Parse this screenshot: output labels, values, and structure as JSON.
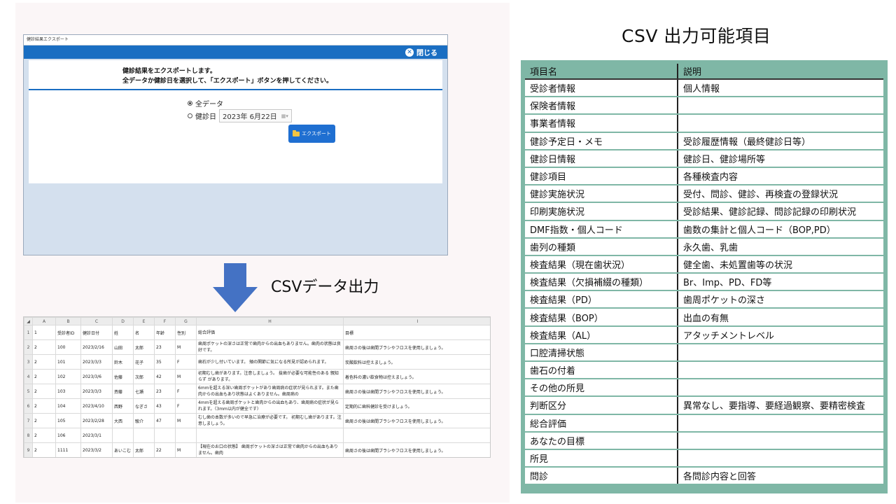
{
  "dialog": {
    "window_title": "健診結果エクスポート",
    "close_label": "閉じる",
    "message_line1": "健診結果をエクスポートします。",
    "message_line2": "全データか健診日を選択して、「エクスポート」ボタンを押してください。",
    "option_all": "全データ",
    "option_date": "健診日",
    "date_value": "2023年  6月22日",
    "export_button": "エクスポート"
  },
  "arrow_caption": "CSVデータ出力",
  "spreadsheet": {
    "columns": [
      "A",
      "B",
      "C",
      "D",
      "E",
      "F",
      "G",
      "H",
      "I"
    ],
    "rows": [
      {
        "n": "1",
        "cells": [
          "1",
          "受診者ID",
          "健診日付",
          "姓",
          "名",
          "年齢",
          "性別",
          "総合評価",
          "目標"
        ]
      },
      {
        "n": "2",
        "cells": [
          "2",
          "100",
          "2023/2/16",
          "山田",
          "太郎",
          "23",
          "M",
          "歯周ポケットの深さは正常で歯肉からの出血もありません。歯肉の状態は良好です。",
          "歯周さの後は歯間ブラシやフロスを使用しましょう。"
        ]
      },
      {
        "n": "3",
        "cells": [
          "2",
          "101",
          "2023/3/3",
          "鈴木",
          "花子",
          "35",
          "F",
          "歯石が少し付いています。 頬の関節に気になる所見が認められます。",
          "炭酸飲料は控えましょう。"
        ]
      },
      {
        "n": "4",
        "cells": [
          "2",
          "102",
          "2023/3/6",
          "佐藤",
          "次郎",
          "42",
          "M",
          "初期むし歯があります。注意しましょう。 抜歯が必要な可能性のある 親知らず があります。",
          "着色料の濃い飲食物は控えましょう。"
        ]
      },
      {
        "n": "5",
        "cells": [
          "2",
          "103",
          "2023/3/3",
          "斉藤",
          "七瀬",
          "23",
          "F",
          "6mmを超える深い歯周ポケットがあり歯周病の症状が見られます。また歯肉からの出血もあり状態はよくありません。歯周病の",
          "歯周さの後は歯間ブラシやフロスを使用しましょう。"
        ]
      },
      {
        "n": "6",
        "cells": [
          "2",
          "104",
          "2023/4/10",
          "西野",
          "なぎさ",
          "43",
          "F",
          "4mmを超える歯周ポケットと歯肉からの出血もあり、歯周病の症状が見られます。（3mm以内が健全です）",
          "定期的に歯科健診を受けましょう。"
        ]
      },
      {
        "n": "7",
        "cells": [
          "2",
          "105",
          "2023/2/28",
          "大西",
          "駿介",
          "47",
          "M",
          "むし歯の本数が多いので早急に治療が必要です。 初期むし歯があります。注意しましょう。",
          "歯周さの後は歯間ブラシやフロスを使用しましょう。"
        ]
      },
      {
        "n": "8",
        "cells": [
          "2",
          "106",
          "2023/3/1",
          "",
          "",
          "",
          "",
          "",
          ""
        ]
      },
      {
        "n": "9",
        "cells": [
          "2",
          "1111",
          "2023/3/2",
          "あいこむ",
          "太郎",
          "22",
          "M",
          "【現在のお口の状態】 歯周ポケットの深さは正常で歯肉からの出血もありません。歯肉",
          "歯周さの後は歯間ブラシやフロスを使用しましょう。"
        ]
      }
    ]
  },
  "csv_items": {
    "title": "CSV 出力可能項目",
    "header": [
      "項目名",
      "説明"
    ],
    "rows": [
      [
        "受診者情報",
        "個人情報"
      ],
      [
        "保険者情報",
        ""
      ],
      [
        "事業者情報",
        ""
      ],
      [
        "健診予定日・メモ",
        "受診履歴情報（最終健診日等）"
      ],
      [
        "健診日情報",
        "健診日、健診場所等"
      ],
      [
        "健診項目",
        "各種検査内容"
      ],
      [
        "健診実施状況",
        "受付、問診、健診、再検査の登録状況"
      ],
      [
        "印刷実施状況",
        "受診結果、健診記録、問診記録の印刷状況"
      ],
      [
        "DMF指数・個人コード",
        "歯数の集計と個人コード（BOP,PD）"
      ],
      [
        "歯列の種類",
        "永久歯、乳歯"
      ],
      [
        "検査結果（現在歯状況）",
        "健全歯、未処置歯等の状況"
      ],
      [
        "検査結果（欠損補綴の種類）",
        "Br、Imp、PD、FD等"
      ],
      [
        "検査結果（PD）",
        "歯周ポケットの深さ"
      ],
      [
        "検査結果（BOP）",
        "出血の有無"
      ],
      [
        "検査結果（AL）",
        "アタッチメントレベル"
      ],
      [
        "口腔清掃状態",
        ""
      ],
      [
        "歯石の付着",
        ""
      ],
      [
        "その他の所見",
        ""
      ],
      [
        "判断区分",
        "異常なし、要指導、要経過観察、要精密検査"
      ],
      [
        "総合評価",
        ""
      ],
      [
        "あなたの目標",
        ""
      ],
      [
        "所見",
        ""
      ],
      [
        "問診",
        "各問診内容と回答"
      ]
    ]
  }
}
